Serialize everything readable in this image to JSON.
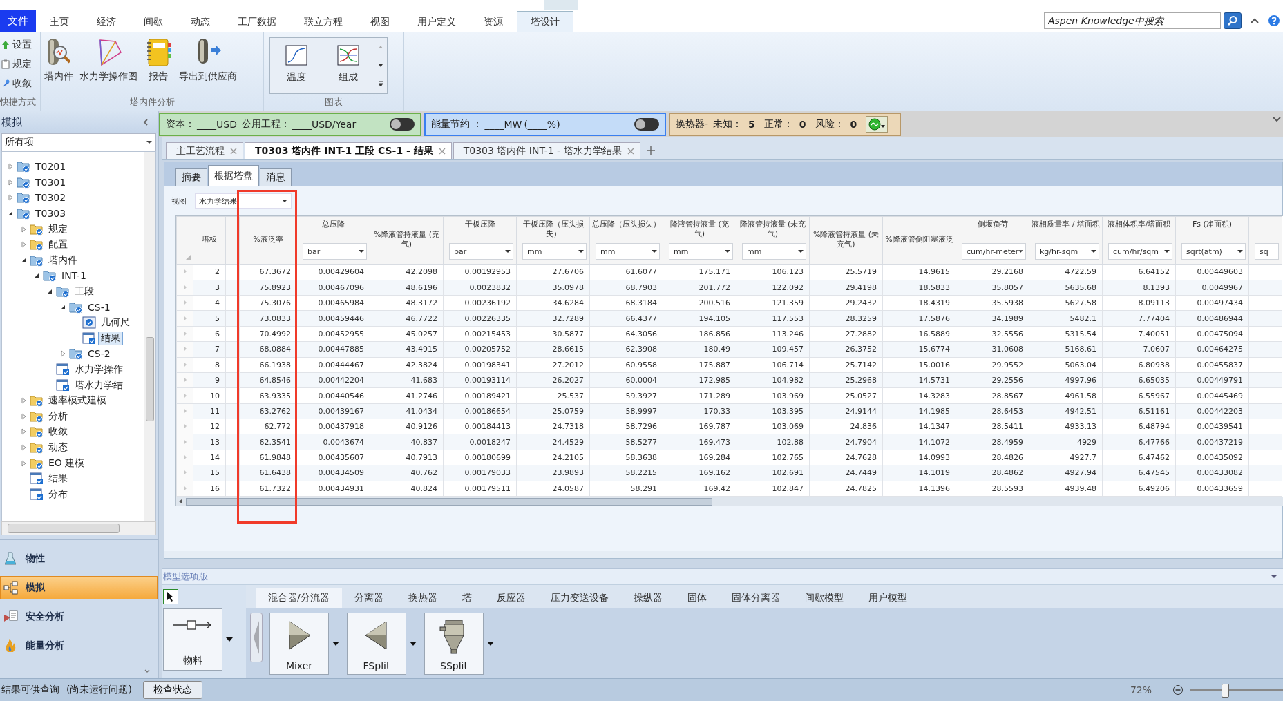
{
  "menu": {
    "file": "文件",
    "tabs": [
      {
        "label": "主页",
        "selected": false
      },
      {
        "label": "经济",
        "selected": false
      },
      {
        "label": "间歇",
        "selected": false
      },
      {
        "label": "动态",
        "selected": false
      },
      {
        "label": "工厂数据",
        "selected": false
      },
      {
        "label": "联立方程",
        "selected": false
      },
      {
        "label": "视图",
        "selected": false
      },
      {
        "label": "用户定义",
        "selected": false
      },
      {
        "label": "资源",
        "selected": false
      },
      {
        "label": "塔设计",
        "selected": true
      }
    ]
  },
  "search": {
    "placeholder": "Aspen Knowledge中搜索"
  },
  "ribbon": {
    "groups": [
      {
        "kind": "shortcuts",
        "label": "快捷方式",
        "items": [
          {
            "kind": "setup",
            "label": "设置"
          },
          {
            "kind": "spec",
            "label": "规定"
          },
          {
            "kind": "converge",
            "label": "收敛"
          }
        ]
      },
      {
        "kind": "large",
        "label": "塔内件分析",
        "items": [
          {
            "kind": "internals",
            "label": "塔内件"
          },
          {
            "kind": "hydraulics",
            "label": "水力学操作图"
          },
          {
            "kind": "report",
            "label": "报告"
          },
          {
            "kind": "export",
            "label": "导出到供应商"
          }
        ]
      },
      {
        "kind": "gallery",
        "label": "图表",
        "items": [
          {
            "kind": "temperature",
            "label": "温度"
          },
          {
            "kind": "composition",
            "label": "组成"
          }
        ]
      }
    ]
  },
  "status_panels": [
    {
      "kind": "cost",
      "items": [
        {
          "kind": "label",
          "text": "资本："
        },
        {
          "kind": "value",
          "text": "____USD"
        },
        {
          "kind": "label",
          "text": "公用工程："
        },
        {
          "kind": "value",
          "text": "____USD/Year"
        }
      ],
      "toggle": {
        "on": false
      }
    },
    {
      "kind": "energy",
      "items": [
        {
          "kind": "label",
          "text": "能量节约 ："
        },
        {
          "kind": "value",
          "text": "____MW"
        },
        {
          "kind": "value",
          "text": "(____%)"
        }
      ],
      "toggle": {
        "on": false
      }
    },
    {
      "kind": "exchanger",
      "items": [
        {
          "kind": "label",
          "text": "换热器-"
        },
        {
          "kind": "label",
          "text": "未知："
        },
        {
          "kind": "count",
          "text": "5"
        },
        {
          "kind": "label",
          "text": "正常："
        },
        {
          "kind": "count",
          "text": "0"
        },
        {
          "kind": "label",
          "text": "风险："
        },
        {
          "kind": "count",
          "text": "0"
        }
      ]
    }
  ],
  "sidebar": {
    "title": "模拟",
    "filter": "所有项",
    "tree": [
      {
        "label": "T0201",
        "kind": "block",
        "expanded": false,
        "selected": false
      },
      {
        "label": "T0301",
        "kind": "block",
        "expanded": false,
        "selected": false
      },
      {
        "label": "T0302",
        "kind": "block",
        "expanded": false,
        "selected": false
      },
      {
        "label": "T0303",
        "kind": "block",
        "expanded": true,
        "selected": false,
        "children": [
          {
            "label": "规定",
            "kind": "folder",
            "expanded": false,
            "selected": false
          },
          {
            "label": "配置",
            "kind": "folder",
            "expanded": false,
            "selected": false
          },
          {
            "label": "塔内件",
            "kind": "block",
            "expanded": true,
            "selected": false,
            "children": [
              {
                "label": "INT-1",
                "kind": "block",
                "expanded": true,
                "selected": false,
                "children": [
                  {
                    "label": "工段",
                    "kind": "block",
                    "expanded": true,
                    "selected": false,
                    "children": [
                      {
                        "label": "CS-1",
                        "kind": "block",
                        "expanded": true,
                        "selected": false,
                        "children": [
                          {
                            "label": "几何尺",
                            "kind": "status",
                            "selected": false
                          },
                          {
                            "label": "结果",
                            "kind": "sheet",
                            "selected": true
                          }
                        ]
                      },
                      {
                        "label": "CS-2",
                        "kind": "block",
                        "expanded": false,
                        "selected": false
                      }
                    ]
                  },
                  {
                    "label": "水力学操作",
                    "kind": "sheet",
                    "selected": false
                  },
                  {
                    "label": "塔水力学结",
                    "kind": "sheet",
                    "selected": false
                  }
                ]
              }
            ]
          },
          {
            "label": "速率模式建模",
            "kind": "folder",
            "expanded": false,
            "selected": false
          },
          {
            "label": "分析",
            "kind": "folder",
            "expanded": false,
            "selected": false
          },
          {
            "label": "收敛",
            "kind": "folder",
            "expanded": false,
            "selected": false
          },
          {
            "label": "动态",
            "kind": "folder",
            "expanded": false,
            "selected": false
          },
          {
            "label": "EO 建模",
            "kind": "folder",
            "expanded": false,
            "selected": false
          },
          {
            "label": "结果",
            "kind": "sheet",
            "selected": false
          },
          {
            "label": "分布",
            "kind": "sheet",
            "selected": false
          }
        ]
      }
    ],
    "nav": [
      {
        "kind": "properties",
        "label": "物性",
        "selected": false
      },
      {
        "kind": "simulation",
        "label": "模拟",
        "selected": true
      },
      {
        "kind": "safety",
        "label": "安全分析",
        "selected": false
      },
      {
        "kind": "energy",
        "label": "能量分析",
        "selected": false
      }
    ]
  },
  "doc_tabs": [
    {
      "label": "主工艺流程",
      "selected": false
    },
    {
      "label": "T0303 塔内件 INT-1 工段 CS-1 - 结果",
      "selected": true
    },
    {
      "label": "T0303 塔内件 INT-1 - 塔水力学结果",
      "selected": false
    }
  ],
  "sub_tabs": [
    {
      "label": "摘要",
      "selected": false
    },
    {
      "label": "根据塔盘",
      "selected": true
    },
    {
      "label": "消息",
      "selected": false
    }
  ],
  "view": {
    "label": "视图",
    "value": "水力学结果"
  },
  "table": {
    "columns": [
      {
        "title": "塔板",
        "highlighted": false
      },
      {
        "title": "%液泛率",
        "highlighted": true
      },
      {
        "title": "总压降",
        "unit": "bar",
        "highlighted": false
      },
      {
        "title": "%降液管持液量 (充气)",
        "highlighted": false
      },
      {
        "title": "干板压降",
        "unit": "bar",
        "highlighted": false
      },
      {
        "title": "干板压降（压头损失）",
        "unit": "mm",
        "highlighted": false
      },
      {
        "title": "总压降（压头损失）",
        "unit": "mm",
        "highlighted": false
      },
      {
        "title": "降液管持液量 (充气)",
        "unit": "mm",
        "highlighted": false
      },
      {
        "title": "降液管持液量 (未充气)",
        "unit": "mm",
        "highlighted": false
      },
      {
        "title": "%降液管持液量 (未充气)",
        "highlighted": false
      },
      {
        "title": "%降液管侧阻塞液泛",
        "highlighted": false
      },
      {
        "title": "侧堰负荷",
        "unit": "cum/hr-meter",
        "highlighted": false
      },
      {
        "title": "液相质量率 / 塔面积",
        "unit": "kg/hr-sqm",
        "highlighted": false
      },
      {
        "title": "液相体积率/塔面积",
        "unit": "cum/hr/sqm",
        "highlighted": false
      },
      {
        "title": "Fs (净面积)",
        "unit": "sqrt(atm)",
        "highlighted": false
      },
      {
        "unit": "sq",
        "highlighted": false
      }
    ],
    "rows": [
      [
        "2",
        "67.3672",
        "0.00429604",
        "42.2098",
        "0.00192953",
        "27.6706",
        "61.6077",
        "175.171",
        "106.123",
        "25.5719",
        "14.9615",
        "29.2168",
        "4722.59",
        "6.64152",
        "0.00449603"
      ],
      [
        "3",
        "75.8923",
        "0.00467096",
        "48.6196",
        "0.0023832",
        "35.0978",
        "68.7903",
        "201.772",
        "122.092",
        "29.4198",
        "18.5833",
        "35.8057",
        "5635.68",
        "8.1393",
        "0.0049967"
      ],
      [
        "4",
        "75.3076",
        "0.00465984",
        "48.3172",
        "0.00236192",
        "34.6284",
        "68.3184",
        "200.516",
        "121.359",
        "29.2432",
        "18.4319",
        "35.5938",
        "5627.58",
        "8.09113",
        "0.00497434"
      ],
      [
        "5",
        "73.0833",
        "0.00459446",
        "46.7722",
        "0.00226335",
        "32.7289",
        "66.4377",
        "194.105",
        "117.553",
        "28.3259",
        "17.5876",
        "34.1989",
        "5482.1",
        "7.77404",
        "0.00486944"
      ],
      [
        "6",
        "70.4992",
        "0.00452955",
        "45.0257",
        "0.00215453",
        "30.5877",
        "64.3056",
        "186.856",
        "113.246",
        "27.2882",
        "16.5889",
        "32.5556",
        "5315.54",
        "7.40051",
        "0.00475094"
      ],
      [
        "7",
        "68.0884",
        "0.00447885",
        "43.4915",
        "0.00205752",
        "28.6615",
        "62.3908",
        "180.49",
        "109.457",
        "26.3752",
        "15.6774",
        "31.0608",
        "5168.61",
        "7.0607",
        "0.00464275"
      ],
      [
        "8",
        "66.1938",
        "0.00444467",
        "42.3824",
        "0.00198341",
        "27.2012",
        "60.9558",
        "175.887",
        "106.714",
        "25.7142",
        "15.0016",
        "29.9552",
        "5063.04",
        "6.80938",
        "0.00455837"
      ],
      [
        "9",
        "64.8546",
        "0.00442204",
        "41.683",
        "0.00193114",
        "26.2027",
        "60.0004",
        "172.985",
        "104.982",
        "25.2968",
        "14.5731",
        "29.2556",
        "4997.96",
        "6.65035",
        "0.00449791"
      ],
      [
        "10",
        "63.9335",
        "0.00440546",
        "41.2746",
        "0.00189421",
        "25.537",
        "59.3927",
        "171.289",
        "103.969",
        "25.0527",
        "14.3283",
        "28.8567",
        "4961.58",
        "6.55967",
        "0.00445469"
      ],
      [
        "11",
        "63.2762",
        "0.00439167",
        "41.0434",
        "0.00186654",
        "25.0759",
        "58.9997",
        "170.33",
        "103.395",
        "24.9144",
        "14.1985",
        "28.6453",
        "4942.51",
        "6.51161",
        "0.00442203"
      ],
      [
        "12",
        "62.772",
        "0.00437918",
        "40.9126",
        "0.00184413",
        "24.7318",
        "58.7296",
        "169.787",
        "103.069",
        "24.836",
        "14.1347",
        "28.5411",
        "4933.13",
        "6.48794",
        "0.00439541"
      ],
      [
        "13",
        "62.3541",
        "0.0043674",
        "40.837",
        "0.0018247",
        "24.4529",
        "58.5277",
        "169.473",
        "102.88",
        "24.7904",
        "14.1072",
        "28.4959",
        "4929",
        "6.47766",
        "0.00437219"
      ],
      [
        "14",
        "61.9848",
        "0.00435607",
        "40.7913",
        "0.00180699",
        "24.2105",
        "58.3638",
        "169.284",
        "102.765",
        "24.7628",
        "14.0993",
        "28.4826",
        "4927.7",
        "6.47462",
        "0.00435092"
      ],
      [
        "15",
        "61.6438",
        "0.00434509",
        "40.762",
        "0.00179033",
        "23.9893",
        "58.2215",
        "169.162",
        "102.691",
        "24.7449",
        "14.1019",
        "28.4862",
        "4927.94",
        "6.47545",
        "0.00433082"
      ],
      [
        "16",
        "61.7322",
        "0.00434931",
        "40.824",
        "0.00179511",
        "24.0587",
        "58.291",
        "169.42",
        "102.847",
        "24.7825",
        "14.1396",
        "28.5593",
        "4939.48",
        "6.49206",
        "0.00433659"
      ]
    ]
  },
  "palette": {
    "title": "模型选项版",
    "tabs": [
      {
        "label": "混合器/分流器",
        "selected": true
      },
      {
        "label": "分离器",
        "selected": false
      },
      {
        "label": "换热器",
        "selected": false
      },
      {
        "label": "塔",
        "selected": false
      },
      {
        "label": "反应器",
        "selected": false
      },
      {
        "label": "压力变送设备",
        "selected": false
      },
      {
        "label": "操纵器",
        "selected": false
      },
      {
        "label": "固体",
        "selected": false
      },
      {
        "label": "固体分离器",
        "selected": false
      },
      {
        "label": "间歇模型",
        "selected": false
      },
      {
        "label": "用户模型",
        "selected": false
      }
    ],
    "stream": {
      "kind": "stream",
      "label": "物料"
    },
    "blocks": [
      {
        "kind": "mixer",
        "label": "Mixer"
      },
      {
        "kind": "fsplit",
        "label": "FSplit"
      },
      {
        "kind": "ssplit",
        "label": "SSplit"
      }
    ]
  },
  "status_bar": {
    "message": "结果可供查询",
    "detail": "(尚未运行问题)",
    "button": "检查状态",
    "zoom": "72%",
    "zoom_slider": {
      "level": 0.35
    }
  }
}
